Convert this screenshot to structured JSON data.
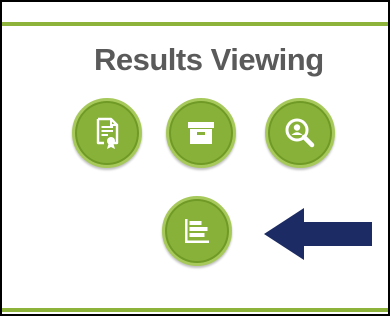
{
  "panel": {
    "title": "Results Viewing"
  },
  "buttons": [
    {
      "icon": "report-certificate-icon"
    },
    {
      "icon": "archive-box-icon"
    },
    {
      "icon": "user-search-icon"
    },
    {
      "icon": "bar-chart-icon"
    }
  ],
  "colors": {
    "button_fill": "#88b13a",
    "button_ring": "#a7c95b",
    "accent_bar": "#8db33a",
    "title_text": "#5a5a5a",
    "arrow": "#1c2b63"
  }
}
